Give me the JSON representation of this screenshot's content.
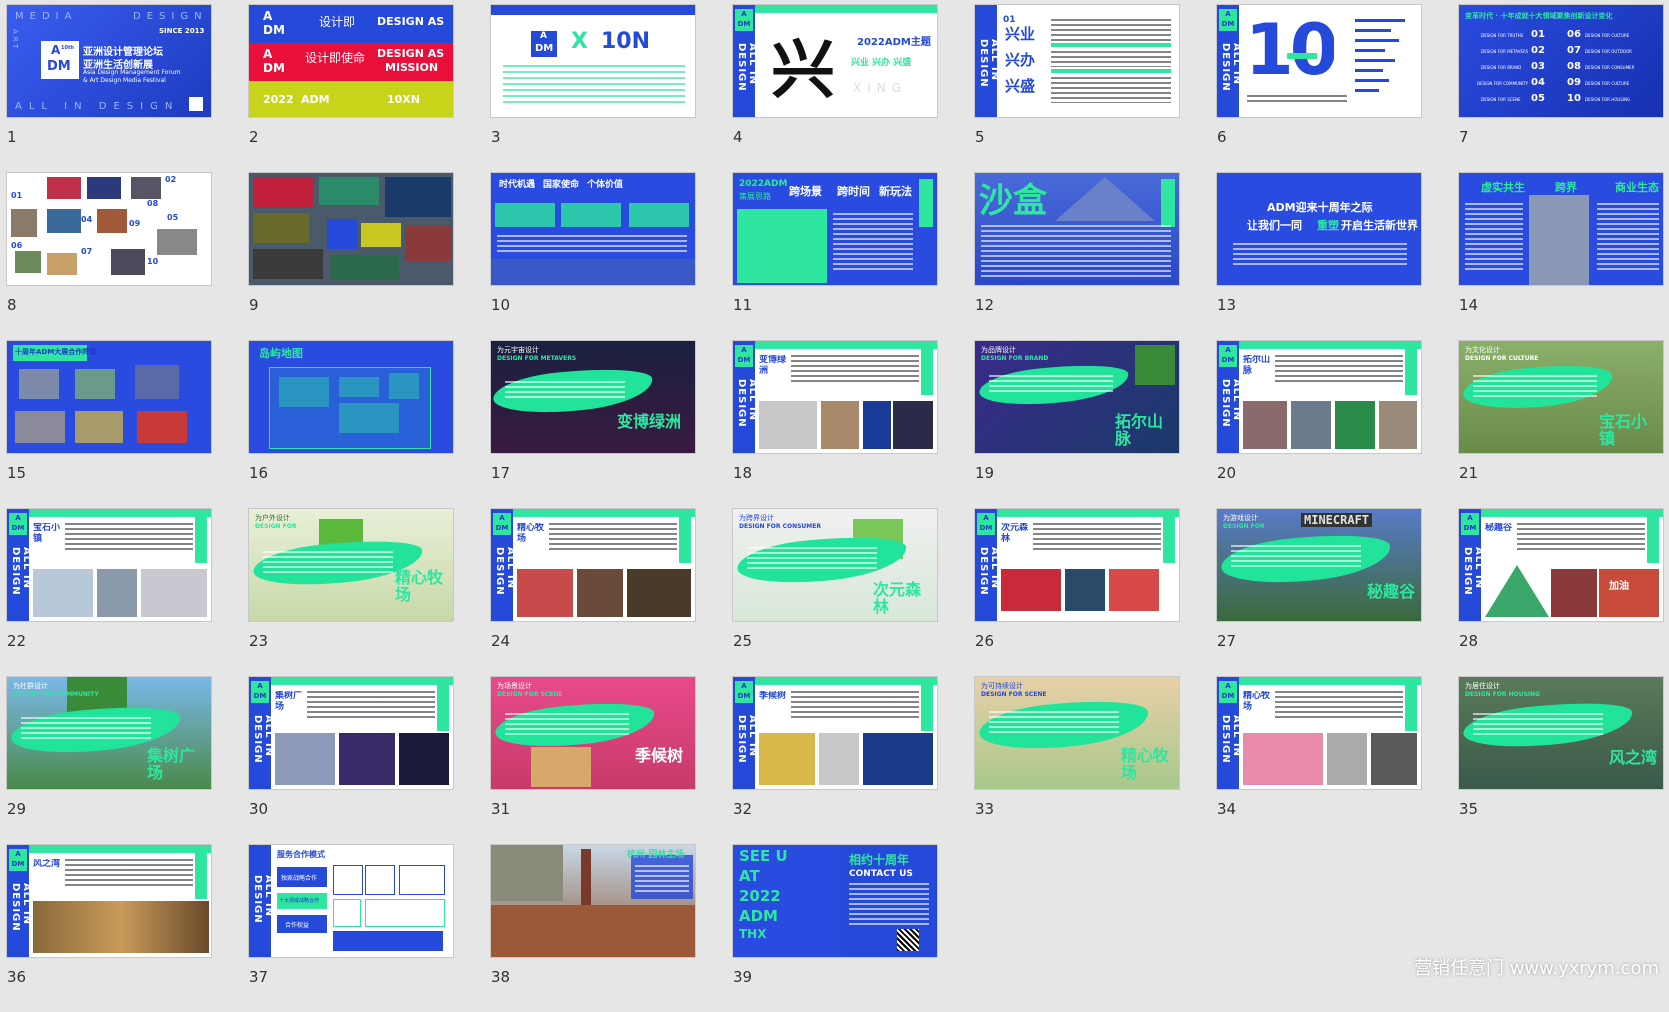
{
  "colors": {
    "brand_blue": "#2549d8",
    "accent_green": "#2ee6a0",
    "red": "#e8103a",
    "yellow": "#c8d41a",
    "background": "#e6e6e6"
  },
  "watermark": "营销任意门 www.yxrym.com",
  "slides": [
    {
      "n": "1"
    },
    {
      "n": "2"
    },
    {
      "n": "3"
    },
    {
      "n": "4"
    },
    {
      "n": "5"
    },
    {
      "n": "6"
    },
    {
      "n": "7"
    },
    {
      "n": "8"
    },
    {
      "n": "9"
    },
    {
      "n": "10"
    },
    {
      "n": "11"
    },
    {
      "n": "12"
    },
    {
      "n": "13"
    },
    {
      "n": "14"
    },
    {
      "n": "15"
    },
    {
      "n": "16"
    },
    {
      "n": "17"
    },
    {
      "n": "18"
    },
    {
      "n": "19"
    },
    {
      "n": "20"
    },
    {
      "n": "21"
    },
    {
      "n": "22"
    },
    {
      "n": "23"
    },
    {
      "n": "24"
    },
    {
      "n": "25"
    },
    {
      "n": "26"
    },
    {
      "n": "27"
    },
    {
      "n": "28"
    },
    {
      "n": "29"
    },
    {
      "n": "30"
    },
    {
      "n": "31"
    },
    {
      "n": "32"
    },
    {
      "n": "33"
    },
    {
      "n": "34"
    },
    {
      "n": "35"
    },
    {
      "n": "36"
    },
    {
      "n": "37"
    },
    {
      "n": "38"
    },
    {
      "n": "39"
    }
  ],
  "s1": {
    "media": "MEDIA",
    "design": "DESIGN",
    "art": "ART",
    "since": "SINCE 2013",
    "logo_a": "A",
    "logo_dm": "DM",
    "logo_th": "10th",
    "cn1": "亚洲设计管理论坛",
    "cn2": "亚洲生活创新展",
    "en1": "Asia Design Management Forum",
    "en2": "& Art Design Media Festival",
    "bottom": "ALL IN DESIGN"
  },
  "s2": {
    "l1": "A",
    "l1b": "DM",
    "r1c": "设计即",
    "r1e": "DESIGN AS",
    "r2c": "设计即使命",
    "r2e1": "DESIGN AS",
    "r2e2": "MISSION",
    "r3a": "2022",
    "r3b": "ADM",
    "r3c": "10XN"
  },
  "s3": {
    "logo_a": "A",
    "logo_dm": "DM",
    "x": "X",
    "ten": "10N"
  },
  "s4": {
    "band": "ALL IN DESIGN",
    "big": "兴",
    "title": "2022ADM主题",
    "sub": "兴业  兴办  兴盛",
    "xing": "XING"
  },
  "s5": {
    "band": "ALL IN DESIGN",
    "n": "01",
    "w1": "兴业",
    "w2": "兴办",
    "w3": "兴盛"
  },
  "s6": {
    "band": "ALL IN DESIGN",
    "big": "10"
  },
  "s7": {
    "title": "变革时代 · 十年成就十大领域聚焦创新设计变化",
    "items": [
      {
        "n": "01",
        "t": "DESIGN FOR TRUTHS"
      },
      {
        "n": "02",
        "t": "DESIGN FOR METAVERS"
      },
      {
        "n": "03",
        "t": "DESIGN FOR BRAND"
      },
      {
        "n": "04",
        "t": "DESIGN FOR COMMUNITY"
      },
      {
        "n": "05",
        "t": "DESIGN FOR SCENE"
      },
      {
        "n": "06",
        "t": "DESIGN FOR CULTURE"
      },
      {
        "n": "07",
        "t": "DESIGN FOR OUTDOOR"
      },
      {
        "n": "08",
        "t": "DESIGN FOR CONSUMER"
      },
      {
        "n": "09",
        "t": "DESIGN FOR CULTURE"
      },
      {
        "n": "10",
        "t": "DESIGN FOR HOUSING"
      }
    ]
  },
  "s8": {
    "n01": "01",
    "n02": "02",
    "n04": "04",
    "n05": "05",
    "n06": "06",
    "n07": "07",
    "n08": "08",
    "n09": "09",
    "n10": "10"
  },
  "s10": {
    "h1": "时代机遇",
    "h2": "国家使命",
    "h3": "个体价值"
  },
  "s11": {
    "t1": "2022ADM",
    "t2": "策展思路",
    "k1": "跨场景",
    "k2": "跨时间",
    "k3": "新玩法"
  },
  "s12": {
    "big": "沙盒"
  },
  "s13": {
    "l1": "ADM迎来十周年之际",
    "l2": "让我们一同",
    "l2b": "重塑",
    "l2c": "开启生活新世界"
  },
  "s14": {
    "k1": "虚实共生",
    "k2": "跨界",
    "k3": "商业生态"
  },
  "s15": {
    "title": "十周年ADM大展合作阵营"
  },
  "s16": {
    "title": "岛屿地图"
  },
  "s17": {
    "small": "为元宇宙设计",
    "en": "DESIGN FOR METAVERS",
    "big": "变博绿洲"
  },
  "s18": {
    "band": "ALL IN DESIGN",
    "tag": "变博绿洲"
  },
  "s19": {
    "small": "为品牌设计",
    "en": "DESIGN FOR BRAND",
    "big": "拓尔山脉"
  },
  "s20": {
    "band": "ALL IN DESIGN",
    "tag": "拓尔山脉"
  },
  "s21": {
    "small": "为文化设计",
    "en": "DESIGN FOR CULTURE",
    "big": "宝石小镇"
  },
  "s22": {
    "band": "ALL IN DESIGN",
    "tag": "宝石小镇"
  },
  "s23": {
    "small": "为户外设计",
    "en": "DESIGN FOR",
    "big": "精心牧场"
  },
  "s24": {
    "band": "ALL IN DESIGN",
    "tag": "精心牧场"
  },
  "s25": {
    "small": "为跨界设计",
    "en": "DESIGN FOR CONSUMER",
    "big": "次元森林"
  },
  "s26": {
    "band": "ALL IN DESIGN",
    "tag": "次元森林"
  },
  "s27": {
    "small": "为游戏设计",
    "en": "DESIGN FOR",
    "logo": "MINECRAFT",
    "big": "秘趣谷"
  },
  "s28": {
    "band": "ALL IN DESIGN",
    "tag": "秘趣谷",
    "sign": "加油"
  },
  "s29": {
    "small": "为社群设计",
    "en": "DESIGN FOR COMMUNITY",
    "big": "集树广场"
  },
  "s30": {
    "band": "ALL IN DESIGN",
    "tag": "集树广场"
  },
  "s31": {
    "small": "为场景设计",
    "en": "DESIGN FOR SCENE",
    "big": "季候树"
  },
  "s32": {
    "band": "ALL IN DESIGN",
    "tag": "季候树"
  },
  "s33": {
    "small": "为可持续设计",
    "en": "DESIGN FOR SCENE",
    "big": "精心牧场"
  },
  "s34": {
    "band": "ALL IN DESIGN",
    "tag": "精心牧场"
  },
  "s35": {
    "small": "为居住设计",
    "en": "DESIGN FOR HOUSING",
    "big": "风之湾"
  },
  "s36": {
    "band": "ALL IN DESIGN",
    "tag": "风之湾"
  },
  "s37": {
    "band": "ALL IN DESIGN",
    "title": "服务合作模式",
    "b1": "独家战略合作",
    "b2": "十大领域战略合作",
    "b3": "合作权益"
  },
  "s38": {
    "title": "杭州·园林主场"
  },
  "s39": {
    "l1": "SEE U",
    "l2": "AT",
    "l3": "2022",
    "l4": "ADM",
    "l5": "THX",
    "r1": "相约十周年",
    "r2": "CONTACT US"
  }
}
